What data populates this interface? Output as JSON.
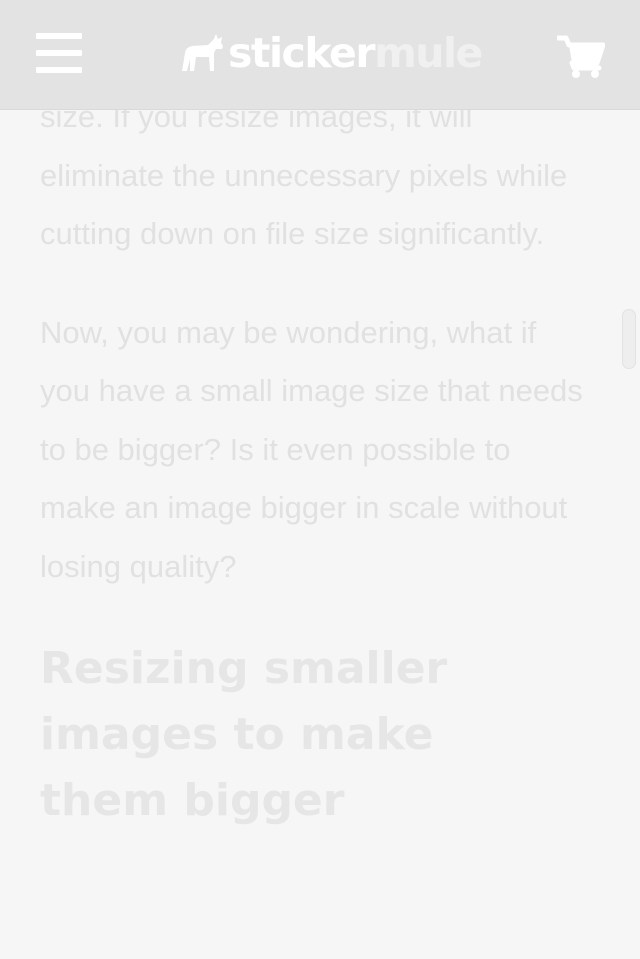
{
  "header": {
    "logo_part1": "sticker",
    "logo_part2": "mule",
    "menu_icon": "hamburger-menu-icon",
    "logo_icon": "mule-icon",
    "cart_icon": "shopping-cart-icon"
  },
  "article": {
    "paragraphs": [
      "size. If you resize images, it will eliminate the unnecessary pixels while cutting down on file size significantly.",
      "Now, you may be wondering, what if you have a small image size that needs to be bigger? Is it even possible to make an image bigger in scale without losing quality?"
    ],
    "heading": "Resizing smaller images to make them bigger"
  },
  "colors": {
    "header_bg": "#e3e3e3",
    "content_bg": "#f6f6f6",
    "text": "#e1e1e1",
    "heading": "#e6e6e6"
  }
}
